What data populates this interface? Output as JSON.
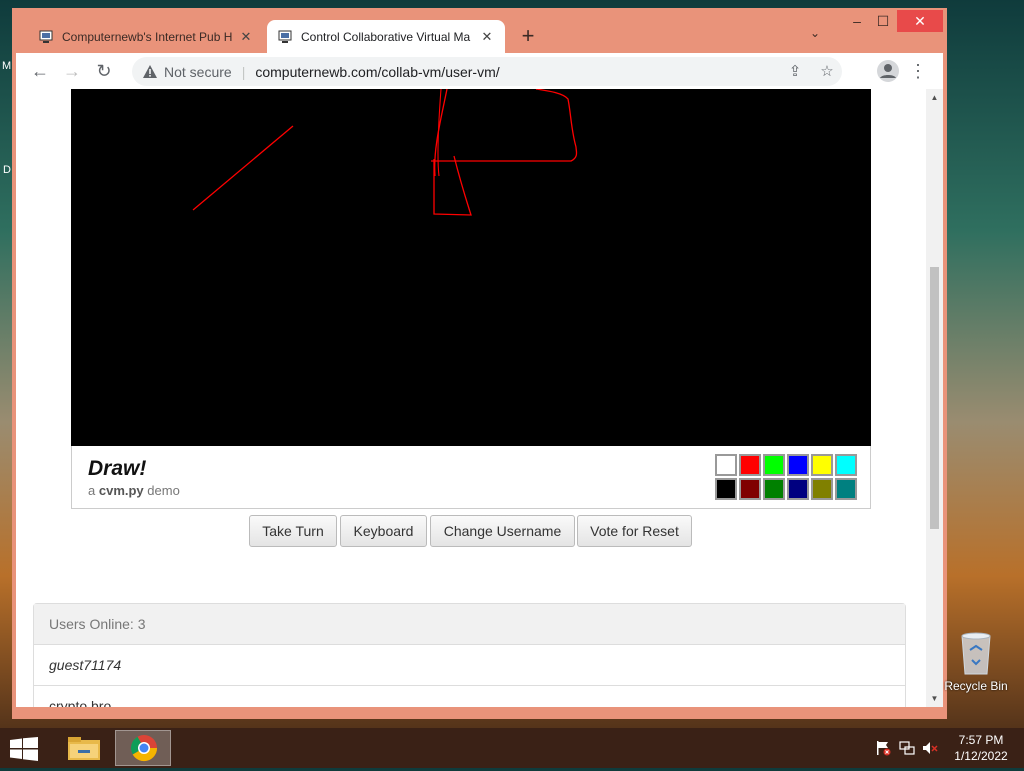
{
  "desktop": {
    "edge_letters": [
      "M",
      "D"
    ],
    "recycle_bin_label": "Recycle Bin"
  },
  "browser": {
    "tabs": [
      {
        "title": "Computernewb's Internet Pub H",
        "active": false
      },
      {
        "title": "Control Collaborative Virtual Ma",
        "active": true
      }
    ],
    "new_tab_symbol": "+",
    "security_label": "Not secure",
    "url": "computernewb.com/collab-vm/user-vm/"
  },
  "page": {
    "draw_title": "Draw!",
    "subtitle": {
      "prefix": "a",
      "name": "cvm.py",
      "suffix": "demo"
    },
    "palette": [
      "#ffffff",
      "#ff0000",
      "#00ff00",
      "#0000ff",
      "#ffff00",
      "#00ffff",
      "#000000",
      "#800000",
      "#008000",
      "#000080",
      "#808000",
      "#008080"
    ],
    "buttons": {
      "take_turn": "Take Turn",
      "keyboard": "Keyboard",
      "change_username": "Change Username",
      "vote_reset": "Vote for Reset"
    },
    "users_header": "Users Online: 3",
    "users": [
      "guest71174",
      "crypto bro"
    ]
  },
  "taskbar": {
    "time": "7:57 PM",
    "date": "1/12/2022"
  },
  "colors": {
    "window_frame": "#e9937a",
    "close_button": "#e84a4a",
    "canvas": "#000000",
    "stroke": "#ff0000"
  }
}
